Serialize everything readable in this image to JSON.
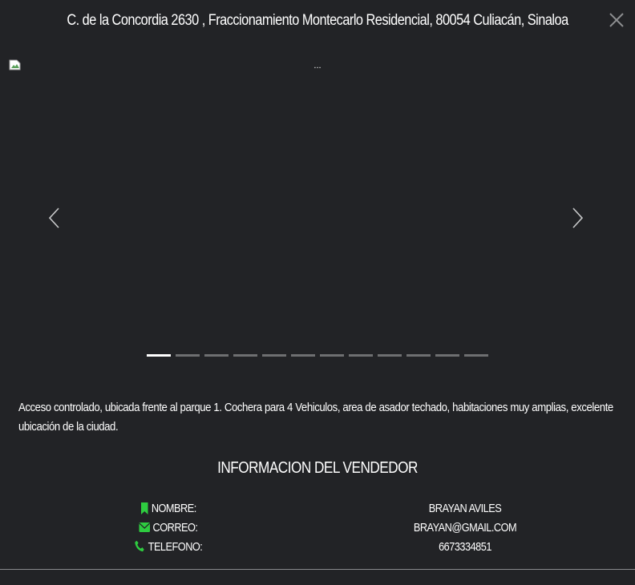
{
  "header": {
    "title": "C. de la Concordia 2630 , Fraccionamiento Montecarlo Residencial, 80054 Culiacán, Sinaloa",
    "close_icon": "close-icon"
  },
  "carousel": {
    "slide_caption": "...",
    "image_icon": "broken-image-icon",
    "prev_icon": "chevron-left-icon",
    "next_icon": "chevron-right-icon",
    "slide_count": 12,
    "active_slide": 1
  },
  "description": "Acceso controlado, ubicada frente al parque 1. Cochera para 4 Vehiculos, area de asador techado, habitaciones muy amplias, excelente ubicación de la ciudad.",
  "seller": {
    "heading": "INFORMACION DEL VENDEDOR",
    "rows": [
      {
        "icon": "bookmark-icon",
        "label": "NOMBRE:",
        "value": "BRAYAN AVILES"
      },
      {
        "icon": "envelope-icon",
        "label": "CORREO:",
        "value": "BRAYAN@GMAIL.COM"
      },
      {
        "icon": "phone-icon",
        "label": "TELEFONO:",
        "value": "6673334851"
      }
    ]
  },
  "colors": {
    "background": "#222326",
    "text": "#ffffff",
    "accent_icon": "#2ecc40",
    "indicator_inactive": "#6e6f71",
    "indicator_active": "#ffffff"
  }
}
